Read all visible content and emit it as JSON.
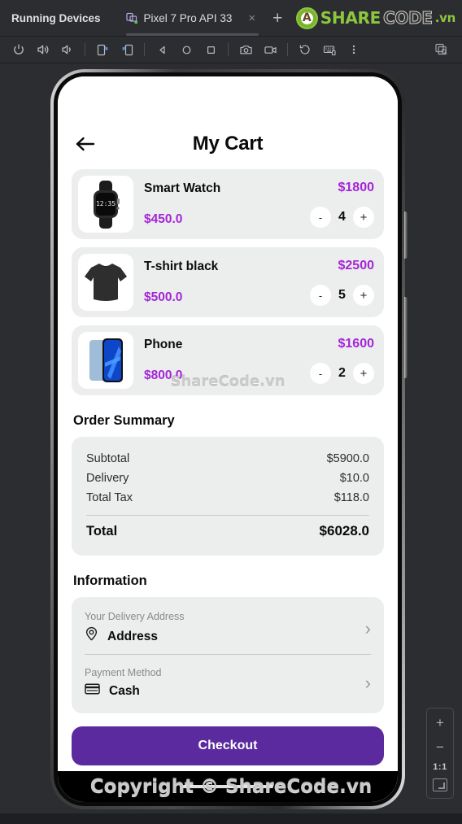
{
  "ide": {
    "tool_window_title": "Running Devices",
    "tab": {
      "label": "Pixel 7 Pro API 33",
      "close": "×",
      "add": "+",
      "icon": "device-icon"
    },
    "toolbar_buttons": [
      {
        "name": "power-icon",
        "title": "Power"
      },
      {
        "name": "volume-up-icon",
        "title": "Volume Up"
      },
      {
        "name": "volume-down-icon",
        "title": "Volume Down"
      },
      {
        "name": "rotate-left-icon",
        "title": "Rotate Left"
      },
      {
        "name": "rotate-right-icon",
        "title": "Rotate Right"
      },
      {
        "name": "back-nav-icon",
        "title": "Back"
      },
      {
        "name": "home-nav-icon",
        "title": "Home"
      },
      {
        "name": "overview-nav-icon",
        "title": "Overview"
      },
      {
        "name": "screenshot-icon",
        "title": "Take Screenshot"
      },
      {
        "name": "record-icon",
        "title": "Record Screen"
      },
      {
        "name": "history-icon",
        "title": "Restore"
      },
      {
        "name": "keyboard-icon",
        "title": "Hardware Input"
      },
      {
        "name": "more-icon",
        "title": "More"
      },
      {
        "name": "device-ui-inspector-icon",
        "title": "UI Inspector"
      }
    ],
    "zoom_panel": {
      "zoom_in": "+",
      "zoom_out": "−",
      "ratio": "1:1",
      "fit": "fit-screen-icon"
    },
    "logo": {
      "part1": "SHARE",
      "part2": "CODE",
      "part3": ".vn",
      "mark": "A"
    }
  },
  "watermarks": {
    "middle": "ShareCode.vn",
    "bottom": "Copyright © ShareCode.vn"
  },
  "app": {
    "title": "My Cart",
    "back_icon": "arrow-left-icon",
    "cart_items": [
      {
        "name": "Smart Watch",
        "unit_price": "$450.0",
        "line_total": "$1800",
        "qty": "4",
        "minus": "-",
        "plus": "+",
        "image": "smart-watch-image"
      },
      {
        "name": "T-shirt black",
        "unit_price": "$500.0",
        "line_total": "$2500",
        "qty": "5",
        "minus": "-",
        "plus": "+",
        "image": "tshirt-image"
      },
      {
        "name": "Phone",
        "unit_price": "$800.0",
        "line_total": "$1600",
        "qty": "2",
        "minus": "-",
        "plus": "+",
        "image": "phone-image"
      }
    ],
    "order_summary": {
      "heading": "Order Summary",
      "rows": [
        {
          "label": "Subtotal",
          "value": "$5900.0"
        },
        {
          "label": "Delivery",
          "value": "$10.0"
        },
        {
          "label": "Total Tax",
          "value": "$118.0"
        }
      ],
      "total": {
        "label": "Total",
        "value": "$6028.0"
      }
    },
    "information": {
      "heading": "Information",
      "address": {
        "caption": "Your Delivery Address",
        "value": "Address",
        "icon": "location-pin-icon",
        "chevron": "›"
      },
      "payment": {
        "caption": "Payment Method",
        "value": "Cash",
        "icon": "credit-card-icon",
        "chevron": "›"
      }
    },
    "checkout_label": "Checkout"
  },
  "colors": {
    "accent_purple": "#a425d6",
    "button_purple": "#5b2a9e",
    "card_gray": "#eceded",
    "ide_bg": "#2b2d30",
    "logo_green": "#8dc63f"
  }
}
